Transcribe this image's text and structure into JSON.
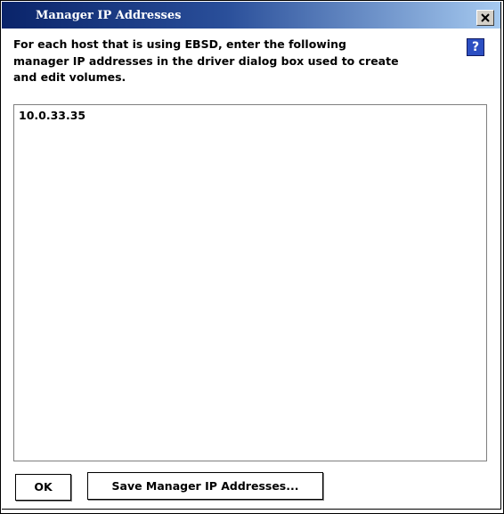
{
  "window": {
    "title": "Manager IP Addresses"
  },
  "description": {
    "line1": "For each host that is using EBSD, enter the following",
    "line2": "manager IP addresses in the driver dialog box used to create",
    "line3": "and edit volumes."
  },
  "help": {
    "label": "?"
  },
  "addresses": {
    "value": "10.0.33.35"
  },
  "buttons": {
    "ok_label": "OK",
    "save_label": "Save Manager IP Addresses..."
  },
  "colors": {
    "titlebar_start": "#0a246a",
    "titlebar_end": "#a6caf0",
    "help_button": "#2c4fc2"
  }
}
